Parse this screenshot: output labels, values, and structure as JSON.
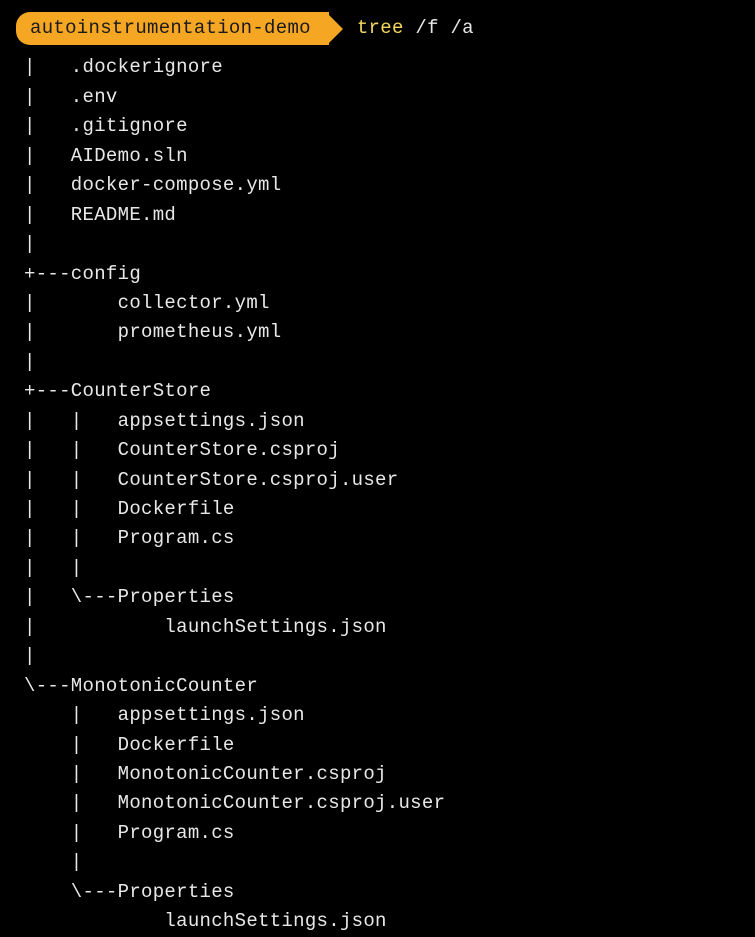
{
  "prompt": {
    "cwd": "autoinstrumentation-demo",
    "command": "tree",
    "args": "/f /a"
  },
  "tree": {
    "lines": [
      "|   .dockerignore",
      "|   .env",
      "|   .gitignore",
      "|   AIDemo.sln",
      "|   docker-compose.yml",
      "|   README.md",
      "|",
      "+---config",
      "|       collector.yml",
      "|       prometheus.yml",
      "|",
      "+---CounterStore",
      "|   |   appsettings.json",
      "|   |   CounterStore.csproj",
      "|   |   CounterStore.csproj.user",
      "|   |   Dockerfile",
      "|   |   Program.cs",
      "|   |",
      "|   \\---Properties",
      "|           launchSettings.json",
      "|",
      "\\---MonotonicCounter",
      "    |   appsettings.json",
      "    |   Dockerfile",
      "    |   MonotonicCounter.csproj",
      "    |   MonotonicCounter.csproj.user",
      "    |   Program.cs",
      "    |",
      "    \\---Properties",
      "            launchSettings.json"
    ]
  }
}
